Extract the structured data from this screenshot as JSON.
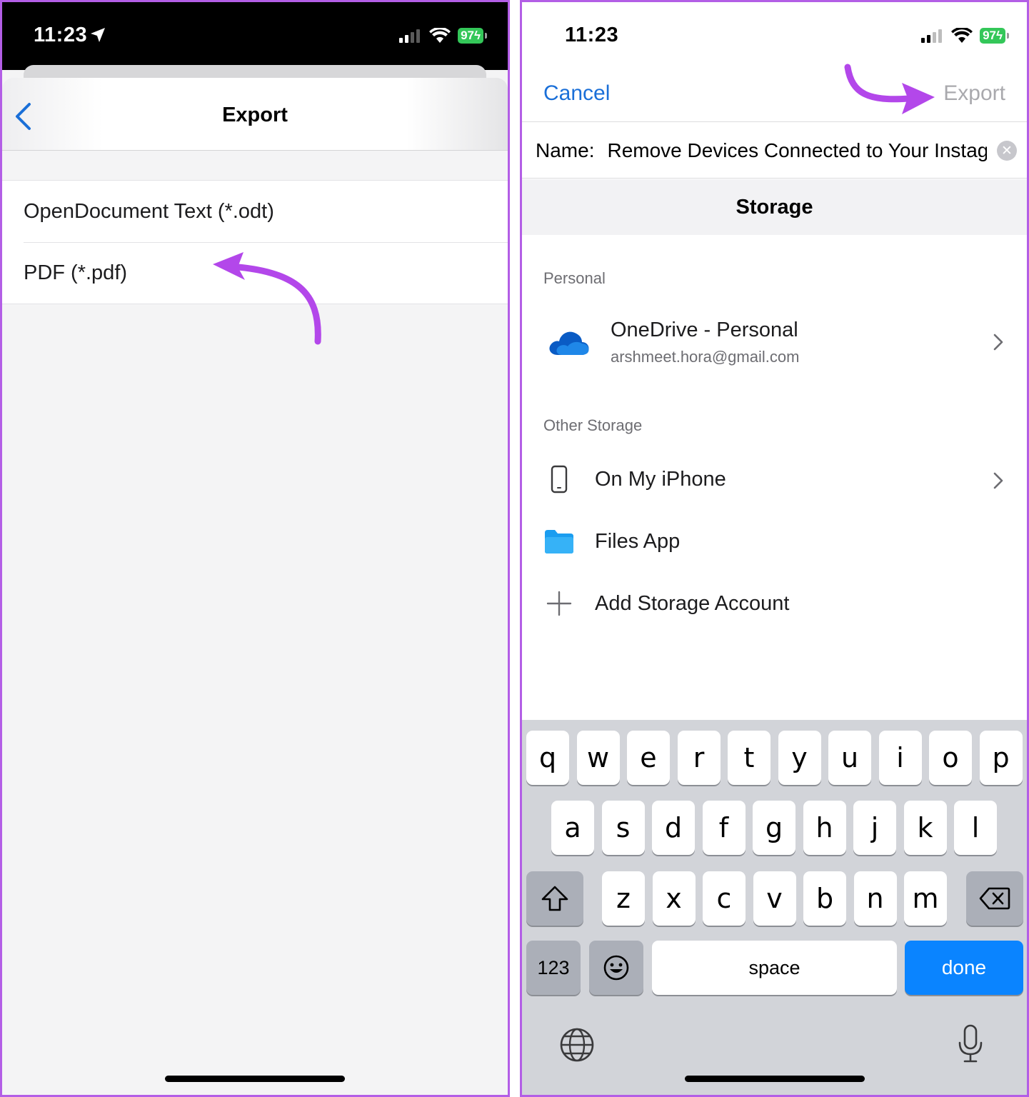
{
  "left": {
    "status": {
      "time": "11:23",
      "battery": "97"
    },
    "title": "Export",
    "options": [
      {
        "label": "OpenDocument Text (*.odt)"
      },
      {
        "label": "PDF (*.pdf)"
      }
    ]
  },
  "right": {
    "status": {
      "time": "11:23",
      "battery": "97"
    },
    "nav": {
      "cancel": "Cancel",
      "export": "Export"
    },
    "name_field": {
      "label": "Name:",
      "value": "Remove Devices Connected to Your Instagram"
    },
    "storage_title": "Storage",
    "sections": {
      "personal": "Personal",
      "other": "Other Storage"
    },
    "account": {
      "name": "OneDrive - Personal",
      "email": "arshmeet.hora@gmail.com"
    },
    "storage_items": [
      {
        "label": "On My iPhone"
      },
      {
        "label": "Files App"
      },
      {
        "label": "Add Storage Account"
      }
    ],
    "keyboard": {
      "row1": [
        "q",
        "w",
        "e",
        "r",
        "t",
        "y",
        "u",
        "i",
        "o",
        "p"
      ],
      "row2": [
        "a",
        "s",
        "d",
        "f",
        "g",
        "h",
        "j",
        "k",
        "l"
      ],
      "row3": [
        "z",
        "x",
        "c",
        "v",
        "b",
        "n",
        "m"
      ],
      "numbers": "123",
      "space": "space",
      "done": "done"
    }
  },
  "colors": {
    "accent": "#1a6fd8",
    "annotation": "#b347ea",
    "done_key": "#0a84ff",
    "battery": "#34c759"
  }
}
